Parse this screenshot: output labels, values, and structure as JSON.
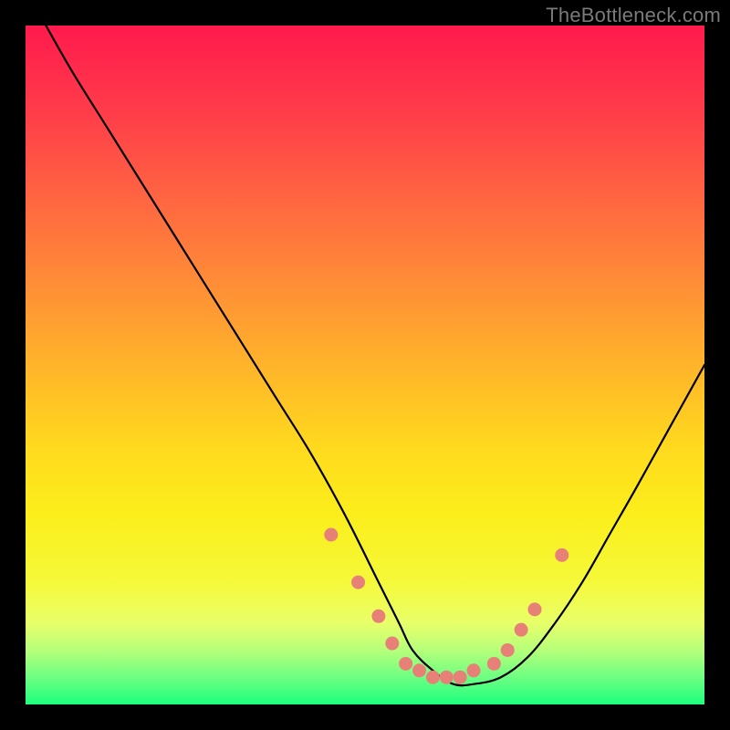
{
  "attribution": "TheBottleneck.com",
  "chart_data": {
    "type": "line",
    "title": "",
    "xlabel": "",
    "ylabel": "",
    "xlim": [
      0,
      100
    ],
    "ylim": [
      0,
      100
    ],
    "grid": false,
    "legend": false,
    "series": [
      {
        "name": "bottleneck-curve",
        "x": [
          3,
          7,
          12,
          17,
          22,
          27,
          32,
          37,
          42,
          47,
          52,
          55,
          57,
          60,
          63,
          66,
          70,
          74,
          78,
          82,
          86,
          90,
          95,
          100
        ],
        "values": [
          100,
          93,
          85,
          77,
          69,
          61,
          53,
          45,
          37,
          28,
          18,
          12,
          8,
          5,
          3,
          3,
          4,
          7,
          12,
          18,
          25,
          32,
          41,
          50
        ]
      }
    ],
    "markers": {
      "name": "valley-dots",
      "color": "#e78178",
      "x": [
        45,
        49,
        52,
        54,
        56,
        58,
        60,
        62,
        64,
        66,
        69,
        71,
        73,
        75,
        79
      ],
      "values": [
        25,
        18,
        13,
        9,
        6,
        5,
        4,
        4,
        4,
        5,
        6,
        8,
        11,
        14,
        22
      ]
    }
  }
}
